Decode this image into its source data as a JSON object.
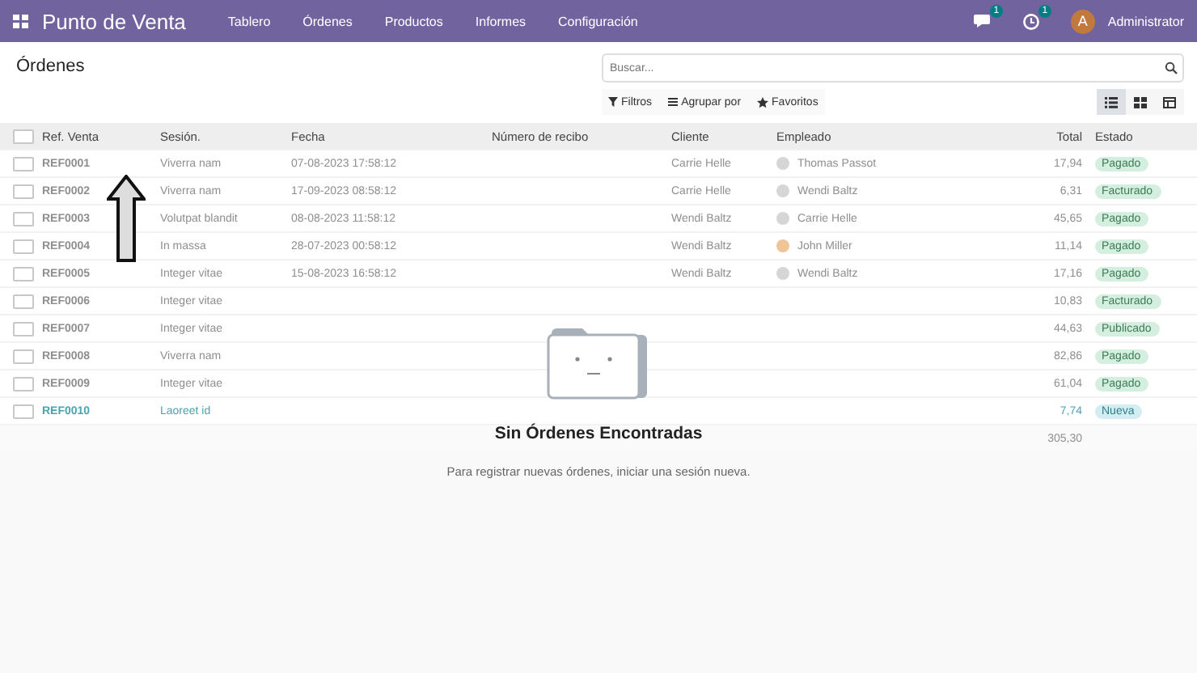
{
  "navbar": {
    "app_title": "Punto de Venta",
    "menu": [
      "Tablero",
      "Órdenes",
      "Productos",
      "Informes",
      "Configuración"
    ],
    "messages_badge": "1",
    "activities_badge": "1",
    "user": {
      "initial": "A",
      "name": "Administrator"
    }
  },
  "breadcrumb": "Órdenes",
  "search": {
    "placeholder": "Buscar..."
  },
  "filters": [
    "Filtros",
    "Agrupar por",
    "Favoritos"
  ],
  "views": [
    {
      "kind": "list",
      "selected": true
    },
    {
      "kind": "kanban",
      "selected": false
    },
    {
      "kind": "pivot",
      "selected": false
    }
  ],
  "table": {
    "columns": [
      "Ref. Venta",
      "Sesión.",
      "Fecha",
      "Número de recibo",
      "Cliente",
      "Empleado",
      "Total",
      "Estado"
    ],
    "select_all_checked": false,
    "rows": [
      {
        "checked": false,
        "highlighted": false,
        "ref": "REF0001",
        "session": "Viverra nam",
        "date": "07-08-2023 17:58:12",
        "client": "Carrie Helle",
        "employee": {
          "name": "Thomas Passot",
          "color": "#d6d6d6"
        },
        "total": "17,94",
        "status": {
          "label": "Pagado",
          "color": "#d4efdf"
        }
      },
      {
        "checked": false,
        "highlighted": false,
        "ref": "REF0002",
        "session": "Viverra nam",
        "date": "17-09-2023 08:58:12",
        "client": "Carrie Helle",
        "employee": {
          "name": "Wendi Baltz",
          "color": "#d6d6d6"
        },
        "total": "6,31",
        "status": {
          "label": "Facturado",
          "color": "#d4efdf"
        }
      },
      {
        "checked": false,
        "highlighted": false,
        "ref": "REF0003",
        "session": "Volutpat blandit",
        "date": "08-08-2023 11:58:12",
        "client": "Wendi Baltz",
        "employee": {
          "name": "Carrie Helle",
          "color": "#d6d6d6"
        },
        "total": "45,65",
        "status": {
          "label": "Pagado",
          "color": "#d4efdf"
        }
      },
      {
        "checked": false,
        "highlighted": false,
        "ref": "REF0004",
        "session": "In massa",
        "date": "28-07-2023 00:58:12",
        "client": "Wendi Baltz",
        "employee": {
          "name": "John Miller",
          "color": "#f0c496"
        },
        "total": "11,14",
        "status": {
          "label": "Pagado",
          "color": "#d4efdf"
        }
      },
      {
        "checked": false,
        "highlighted": false,
        "ref": "REF0005",
        "session": "Integer vitae",
        "date": "15-08-2023 16:58:12",
        "client": "Wendi Baltz",
        "employee": {
          "name": "Wendi Baltz",
          "color": "#d6d6d6"
        },
        "total": "17,16",
        "status": {
          "label": "Pagado",
          "color": "#d4efdf"
        }
      },
      {
        "checked": false,
        "highlighted": false,
        "ref": "REF0006",
        "session": "Integer vitae",
        "total": "10,83",
        "status": {
          "label": "Facturado",
          "color": "#d4efdf"
        }
      },
      {
        "checked": false,
        "highlighted": false,
        "ref": "REF0007",
        "session": "Integer vitae",
        "total": "44,63",
        "status": {
          "label": "Publicado",
          "color": "#d4efdf"
        }
      },
      {
        "checked": false,
        "highlighted": false,
        "ref": "REF0008",
        "session": "Viverra nam",
        "total": "82,86",
        "status": {
          "label": "Pagado",
          "color": "#d4efdf"
        }
      },
      {
        "checked": false,
        "highlighted": false,
        "ref": "REF0009",
        "session": "Integer vitae",
        "total": "61,04",
        "status": {
          "label": "Pagado",
          "color": "#d4efdf"
        }
      },
      {
        "checked": false,
        "highlighted": true,
        "ref": "REF0010",
        "session": "Laoreet id",
        "total": "7,74",
        "status": {
          "label": "Nueva",
          "color": "#d3eef3"
        }
      }
    ],
    "grand_total": "305,30"
  },
  "empty_state": {
    "title": "Sin Órdenes Encontradas",
    "message": "Para registrar nuevas órdenes, iniciar una sesión nueva."
  }
}
